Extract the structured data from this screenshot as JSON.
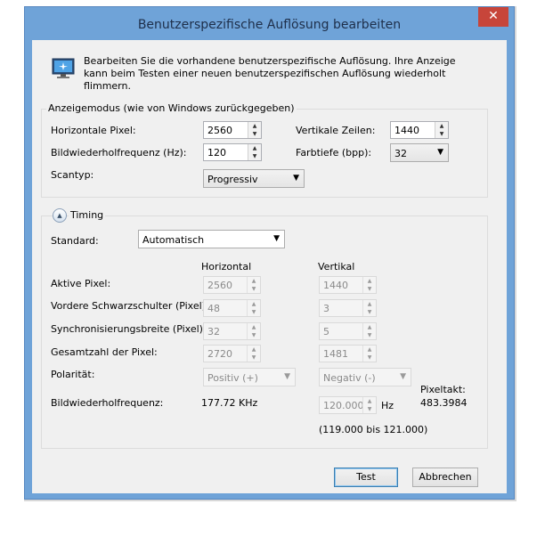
{
  "window": {
    "title": "Benutzerspezifische Auflösung bearbeiten",
    "close_glyph": "✕"
  },
  "info": {
    "icon": "monitor-icon",
    "text": "Bearbeiten Sie die vorhandene benutzerspezifische Auflösung. Ihre Anzeige kann beim Testen einer neuen benutzerspezifischen Auflösung wiederholt flimmern."
  },
  "display_mode": {
    "group_label": "Anzeigemodus (wie von Windows zurückgegeben)",
    "horizontal_pixels_label": "Horizontale Pixel:",
    "horizontal_pixels_value": "2560",
    "vertical_lines_label": "Vertikale Zeilen:",
    "vertical_lines_value": "1440",
    "refresh_rate_label": "Bildwiederholfrequenz (Hz):",
    "refresh_rate_value": "120",
    "color_depth_label": "Farbtiefe (bpp):",
    "color_depth_value": "32",
    "scan_type_label": "Scantyp:",
    "scan_type_value": "Progressiv"
  },
  "timing": {
    "toggle_label": "Timing",
    "standard_label": "Standard:",
    "standard_value": "Automatisch",
    "col_horizontal": "Horizontal",
    "col_vertical": "Vertikal",
    "rows": [
      {
        "label": "Aktive Pixel:",
        "h": "2560",
        "v": "1440"
      },
      {
        "label": "Vordere Schwarzschulter (Pixel):",
        "h": "48",
        "v": "3"
      },
      {
        "label": "Synchronisierungsbreite (Pixel):",
        "h": "32",
        "v": "5"
      },
      {
        "label": "Gesamtzahl der Pixel:",
        "h": "2720",
        "v": "1481"
      }
    ],
    "polarity_label": "Polarität:",
    "polarity_h": "Positiv (+)",
    "polarity_v": "Negativ (-)",
    "refresh_label": "Bildwiederholfrequenz:",
    "refresh_h": "177.72 KHz",
    "refresh_v": "120.000",
    "refresh_v_unit": "Hz",
    "refresh_range": "(119.000 bis 121.000)",
    "pixel_clock_label": "Pixeltakt:",
    "pixel_clock_value": "483.3984"
  },
  "buttons": {
    "test": "Test",
    "cancel": "Abbrechen"
  }
}
